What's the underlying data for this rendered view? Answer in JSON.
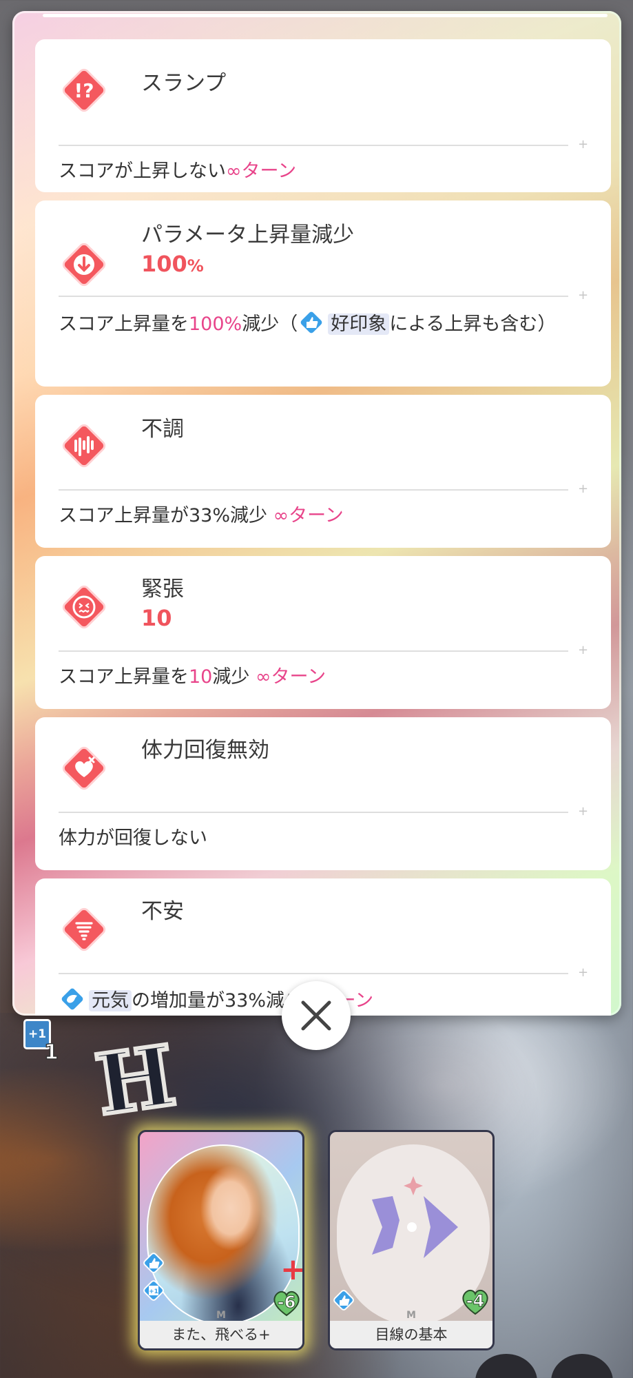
{
  "status_effects": [
    {
      "icon": "scramble-question-icon",
      "title": "スランプ",
      "amount": "",
      "amount_unit": "",
      "desc_parts": [
        "スコアが上昇しない",
        "∞ターン"
      ]
    },
    {
      "icon": "down-arrow-icon",
      "title": "パラメータ上昇量減少",
      "amount": "100",
      "amount_unit": "%",
      "desc_parts": [
        "スコア上昇量を",
        "100%",
        "減少（",
        "好印象",
        "による上昇も含む）"
      ]
    },
    {
      "icon": "waveform-icon",
      "title": "不調",
      "amount": "",
      "amount_unit": "",
      "desc_parts": [
        "スコア上昇量が33%減少 ",
        "∞ターン"
      ]
    },
    {
      "icon": "tense-face-icon",
      "title": "緊張",
      "amount": "10",
      "amount_unit": "",
      "desc_parts": [
        "スコア上昇量を",
        "10",
        "減少 ",
        "∞ターン"
      ]
    },
    {
      "icon": "broken-heart-icon",
      "title": "体力回復無効",
      "amount": "",
      "amount_unit": "",
      "desc_parts": [
        "体力が回復しない"
      ]
    },
    {
      "icon": "tornado-icon",
      "title": "不安",
      "amount": "",
      "amount_unit": "",
      "desc_parts": [
        "元気",
        "の増加量が33%減少",
        "∞ターン"
      ]
    }
  ],
  "plus_badge": {
    "label": "+1",
    "count": "1"
  },
  "hand": [
    {
      "name": "また、飛べる+",
      "cost": "-6",
      "rarity": "M"
    },
    {
      "name": "目線の基本",
      "cost": "-4",
      "rarity": "M"
    }
  ],
  "colors": {
    "accent_red": "#f0545d",
    "accent_pink": "#e8448a",
    "highlight_bg": "#e4e8f6"
  }
}
